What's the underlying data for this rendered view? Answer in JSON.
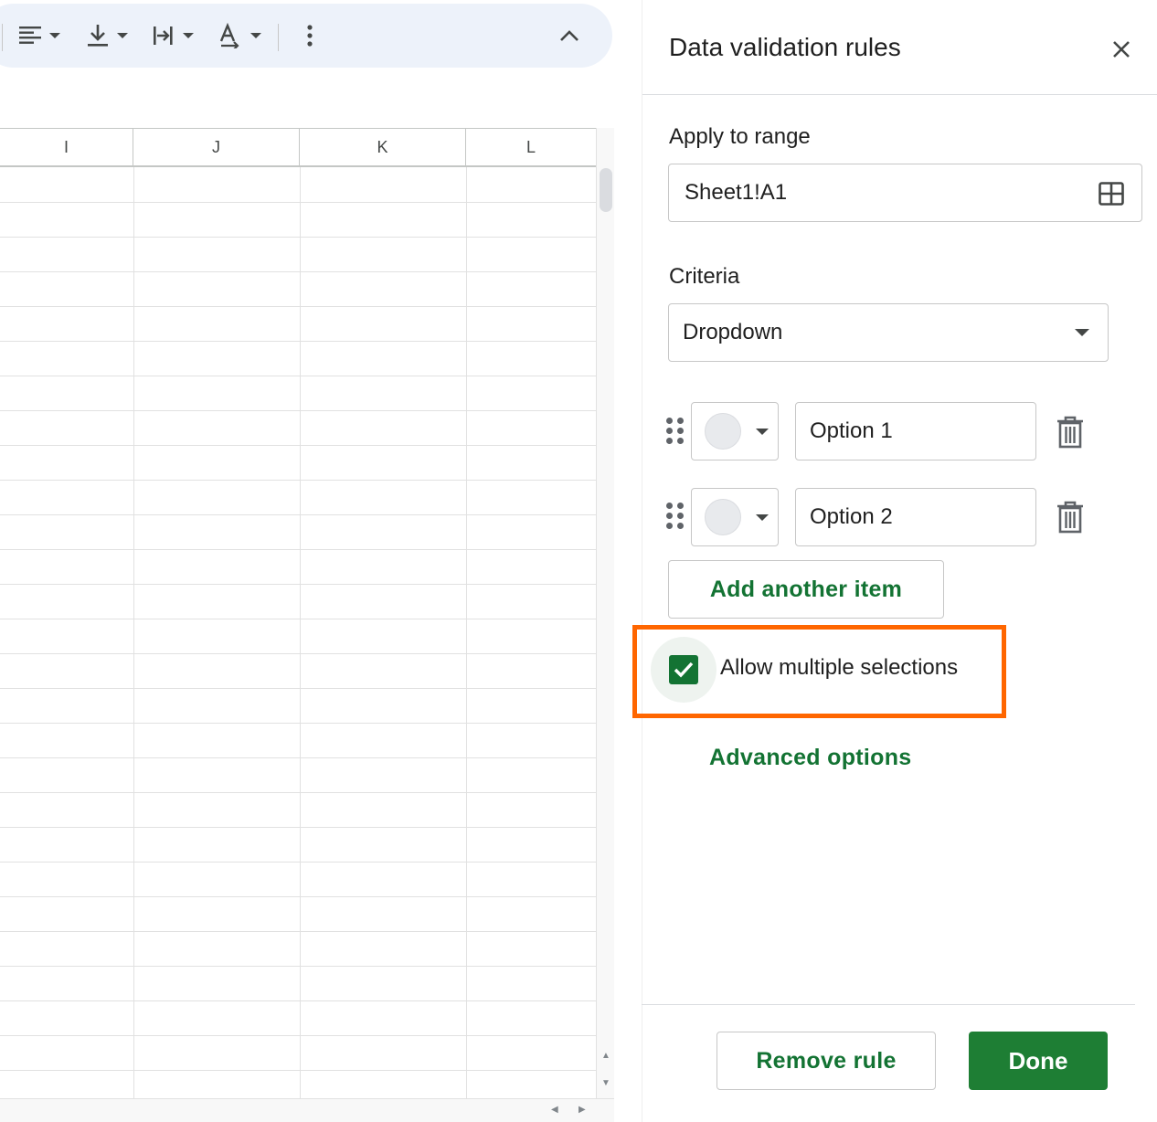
{
  "sheet": {
    "columns": [
      "I",
      "J",
      "K",
      "L"
    ]
  },
  "panel": {
    "title": "Data validation rules",
    "apply_to_range": {
      "label": "Apply to range",
      "value": "Sheet1!A1"
    },
    "criteria": {
      "label": "Criteria",
      "selected": "Dropdown"
    },
    "options": [
      {
        "value": "Option 1"
      },
      {
        "value": "Option 2"
      }
    ],
    "add_item_label": "Add another item",
    "allow_multiple": {
      "label": "Allow multiple selections",
      "checked": true
    },
    "advanced_label": "Advanced options",
    "remove_label": "Remove rule",
    "done_label": "Done"
  },
  "colors": {
    "accent_green": "#137333",
    "highlight": "#ff6600",
    "toolbar_bg": "#edf2fa"
  },
  "icons": [
    "align-left-icon",
    "vertical-align-icon",
    "text-wrap-icon",
    "text-rotation-icon",
    "more-vert-icon",
    "chevron-up-icon",
    "close-icon",
    "grid-select-icon",
    "dropdown-arrow-icon",
    "drag-handle-icon",
    "trash-icon",
    "check-icon"
  ]
}
